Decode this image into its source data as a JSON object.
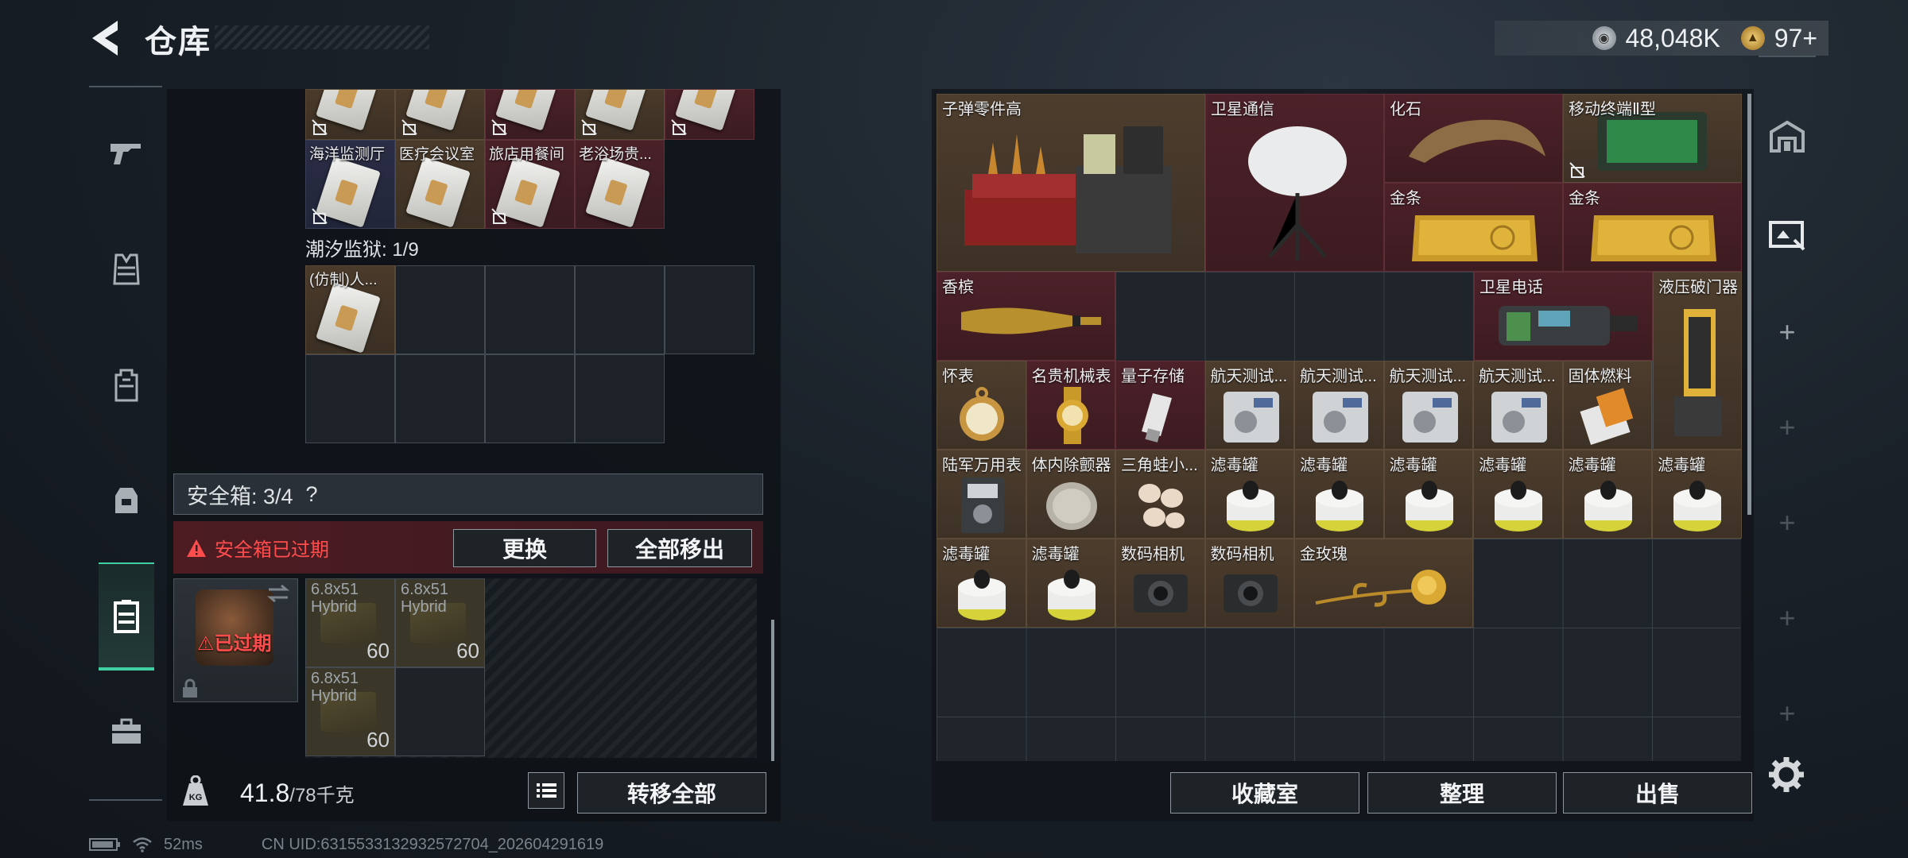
{
  "header": {
    "title": "仓库",
    "currency": [
      {
        "icon": "silver-coin-icon",
        "value": "48,048K"
      },
      {
        "icon": "gold-coin-icon",
        "value": "97+"
      }
    ]
  },
  "left_nav": [
    {
      "icon": "gun-icon",
      "active": false
    },
    {
      "icon": "vest-icon",
      "active": false
    },
    {
      "icon": "backpack-icon",
      "active": false
    },
    {
      "icon": "pouch-icon",
      "active": false
    },
    {
      "icon": "case-icon",
      "active": true
    },
    {
      "icon": "briefcase-icon",
      "active": false
    }
  ],
  "keycards": {
    "row1": [
      {
        "name": ""
      },
      {
        "name": ""
      },
      {
        "name": ""
      },
      {
        "name": ""
      },
      {
        "name": ""
      }
    ],
    "row2": [
      {
        "name": "海洋监测厅"
      },
      {
        "name": "医疗会议室"
      },
      {
        "name": "旅店用餐间"
      },
      {
        "name": "老浴场贵..."
      }
    ],
    "prison_label": "潮汐监狱: 1/9",
    "prison_item": "(仿制)人..."
  },
  "safe_box": {
    "label": "安全箱: 3/4",
    "help": "?",
    "expired_msg": "安全箱已过期",
    "replace_btn": "更换",
    "remove_all_btn": "全部移出",
    "case_status": "已过期",
    "ammo": [
      {
        "name": "6.8x51\nHybrid",
        "count": "60"
      },
      {
        "name": "6.8x51\nHybrid",
        "count": "60"
      },
      {
        "name": "6.8x51\nHybrid",
        "count": "60"
      }
    ]
  },
  "weight": {
    "current": "41.8",
    "max": "/78千克"
  },
  "transfer_all": "转移全部",
  "storage_items": [
    {
      "name": "子弹零件高",
      "color": "brown",
      "icon": "ammo-parts-icon"
    },
    {
      "name": "卫星通信",
      "color": "red",
      "icon": "satellite-dish-icon"
    },
    {
      "name": "化石",
      "color": "red",
      "icon": "fossil-claw-icon"
    },
    {
      "name": "移动终端Ⅱ型",
      "color": "brown",
      "icon": "mobile-terminal-icon"
    },
    {
      "name": "金条",
      "color": "red",
      "icon": "gold-bar-icon"
    },
    {
      "name": "金条",
      "color": "red",
      "icon": "gold-bar-icon"
    },
    {
      "name": "香槟",
      "color": "red",
      "icon": "champagne-icon"
    },
    {
      "name": "卫星电话",
      "color": "red",
      "icon": "satellite-phone-icon"
    },
    {
      "name": "液压破门器",
      "color": "brown",
      "icon": "hydraulic-breacher-icon"
    },
    {
      "name": "怀表",
      "color": "brown",
      "icon": "pocket-watch-icon"
    },
    {
      "name": "名贵机械表",
      "color": "red",
      "icon": "watch-icon"
    },
    {
      "name": "量子存储",
      "color": "red",
      "icon": "usb-drive-icon"
    },
    {
      "name": "航天测试...",
      "color": "brown",
      "icon": "test-device-icon"
    },
    {
      "name": "航天测试...",
      "color": "brown",
      "icon": "test-device-icon"
    },
    {
      "name": "航天测试...",
      "color": "brown",
      "icon": "test-device-icon"
    },
    {
      "name": "航天测试...",
      "color": "brown",
      "icon": "test-device-icon"
    },
    {
      "name": "固体燃料",
      "color": "brown",
      "icon": "solid-fuel-icon"
    },
    {
      "name": "陆军万用表",
      "color": "brown",
      "icon": "multimeter-icon"
    },
    {
      "name": "体内除颤器",
      "color": "brown",
      "icon": "defibrillator-icon"
    },
    {
      "name": "三角蛙小...",
      "color": "brown",
      "icon": "frog-eggs-icon"
    },
    {
      "name": "滤毒罐",
      "color": "brown",
      "icon": "filter-canister-icon"
    },
    {
      "name": "滤毒罐",
      "color": "brown",
      "icon": "filter-canister-icon"
    },
    {
      "name": "滤毒罐",
      "color": "brown",
      "icon": "filter-canister-icon"
    },
    {
      "name": "滤毒罐",
      "color": "brown",
      "icon": "filter-canister-icon"
    },
    {
      "name": "滤毒罐",
      "color": "brown",
      "icon": "filter-canister-icon"
    },
    {
      "name": "滤毒罐",
      "color": "brown",
      "icon": "filter-canister-icon"
    },
    {
      "name": "滤毒罐",
      "color": "brown",
      "icon": "filter-canister-icon"
    },
    {
      "name": "滤毒罐",
      "color": "brown",
      "icon": "filter-canister-icon"
    },
    {
      "name": "数码相机",
      "color": "brown",
      "icon": "camera-icon"
    },
    {
      "name": "数码相机",
      "color": "brown",
      "icon": "camera-icon"
    },
    {
      "name": "金玫瑰",
      "color": "brown",
      "icon": "gold-rose-icon"
    }
  ],
  "right_nav": [
    {
      "icon": "storage-room-icon"
    },
    {
      "icon": "collection-icon"
    },
    {
      "icon": "plus-icon"
    },
    {
      "icon": "plus-icon"
    },
    {
      "icon": "plus-icon"
    },
    {
      "icon": "plus-icon"
    },
    {
      "icon": "plus-icon"
    }
  ],
  "bottom_buttons": {
    "collection": "收藏室",
    "organize": "整理",
    "sell": "出售"
  },
  "status": {
    "ping": "52ms",
    "uid": "CN UID:6315533132932572704_202604291619"
  }
}
